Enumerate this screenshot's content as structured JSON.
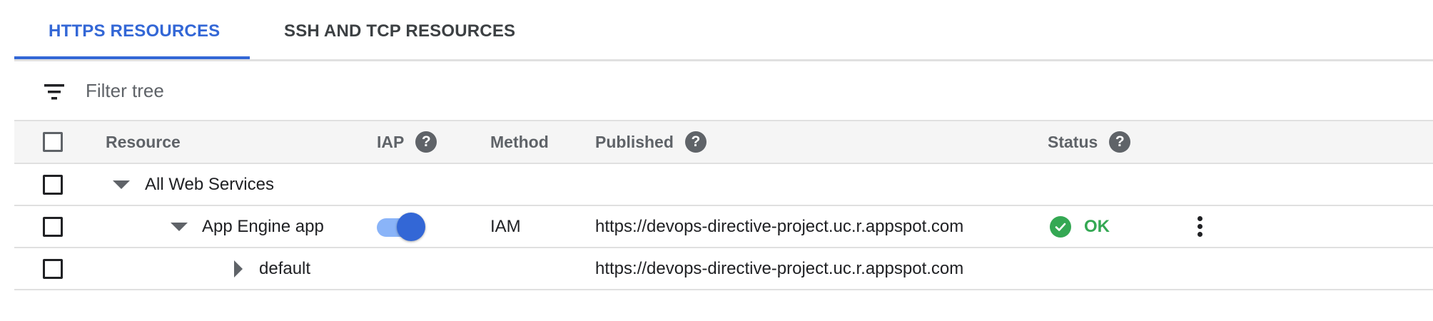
{
  "tabs": [
    {
      "label": "HTTPS RESOURCES",
      "active": true
    },
    {
      "label": "SSH AND TCP RESOURCES",
      "active": false
    }
  ],
  "filter": {
    "placeholder": "Filter tree",
    "icon": "filter-list-icon"
  },
  "table": {
    "columns": {
      "resource": "Resource",
      "iap": "IAP",
      "method": "Method",
      "published": "Published",
      "status": "Status"
    },
    "rows": [
      {
        "resource": "All Web Services",
        "expanded": true,
        "iap": "",
        "method": "",
        "published": "",
        "status": ""
      },
      {
        "resource": "App Engine app",
        "expanded": true,
        "iap_enabled": true,
        "method": "IAM",
        "published": "https://devops-directive-project.uc.r.appspot.com",
        "status": "OK"
      },
      {
        "resource": "default",
        "expanded": false,
        "iap": "",
        "method": "",
        "published": "https://devops-directive-project.uc.r.appspot.com",
        "status": ""
      }
    ]
  },
  "colors": {
    "accent": "#3367d6",
    "ok": "#34a853",
    "header_bg": "#f5f5f5"
  }
}
